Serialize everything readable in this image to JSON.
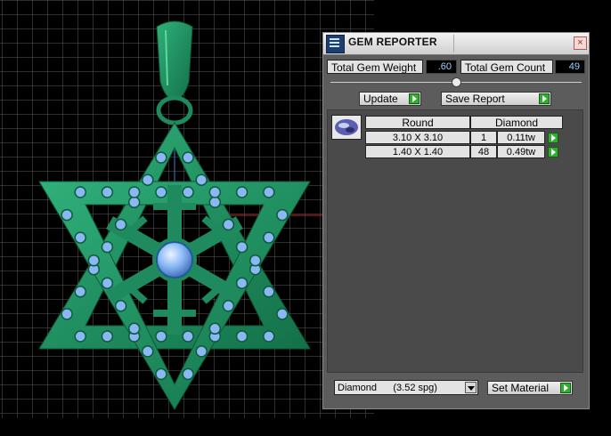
{
  "dialog": {
    "title": "GEM REPORTER",
    "close_label": "×",
    "total_weight_label": "Total Gem Weight",
    "total_weight_value": ".60",
    "total_count_label": "Total Gem Count",
    "total_count_value": "49",
    "update_label": "Update",
    "save_report_label": "Save Report"
  },
  "table": {
    "headers": [
      "Round",
      "Diamond"
    ],
    "rows": [
      {
        "size": "3.10 X 3.10",
        "count": "1",
        "weight": "0.11tw"
      },
      {
        "size": "1.40 X 1.40",
        "count": "48",
        "weight": "0.49tw"
      }
    ]
  },
  "material": {
    "selected": "Diamond      (3.52 spg)",
    "set_label": "Set Material"
  },
  "colors": {
    "pendant_metal": "#1e8a5e",
    "gem_blue": "#8ab8f5",
    "grid_line": "#5a5a5a",
    "accent_green_button": "#2fae2f"
  },
  "icons": {
    "title_icon": "gem-reporter-app-icon",
    "gem_shape_icon": "round-gem-icon",
    "close_icon": "close-icon",
    "go_arrow_icon": "play-arrow-icon"
  }
}
